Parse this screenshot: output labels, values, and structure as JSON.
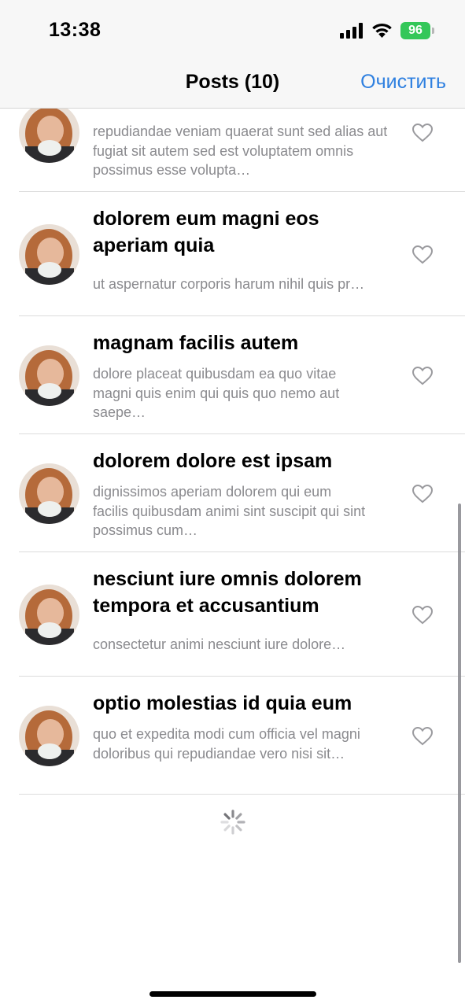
{
  "status_bar": {
    "time": "13:38",
    "battery": "96"
  },
  "nav": {
    "title": "Posts (10)",
    "clear_label": "Очистить"
  },
  "posts": [
    {
      "title": "",
      "body": "repudiandae veniam quaerat sunt sed alias aut fugiat sit autem sed est voluptatem omnis possimus esse volupta…"
    },
    {
      "title": "dolorem eum magni eos aperiam quia",
      "body": "ut aspernatur corporis harum nihil quis pr…"
    },
    {
      "title": "magnam facilis autem",
      "body": "dolore placeat quibusdam ea quo vitae magni quis enim qui quis quo nemo aut saepe…"
    },
    {
      "title": "dolorem dolore est ipsam",
      "body": "dignissimos aperiam dolorem qui eum facilis quibusdam animi sint suscipit qui sint possimus cum…"
    },
    {
      "title": "nesciunt iure omnis dolorem tempora et accusantium",
      "body": "consectetur animi nesciunt iure dolore…"
    },
    {
      "title": "optio molestias id quia eum",
      "body": "quo et expedita modi cum officia vel magni doloribus qui repudiandae vero nisi sit…"
    }
  ],
  "icons": {
    "like": "heart-outline-icon",
    "loading": "spinner-icon"
  },
  "colors": {
    "accent": "#2f80e0",
    "battery": "#34c759",
    "secondary_text": "#8a8a8e"
  }
}
